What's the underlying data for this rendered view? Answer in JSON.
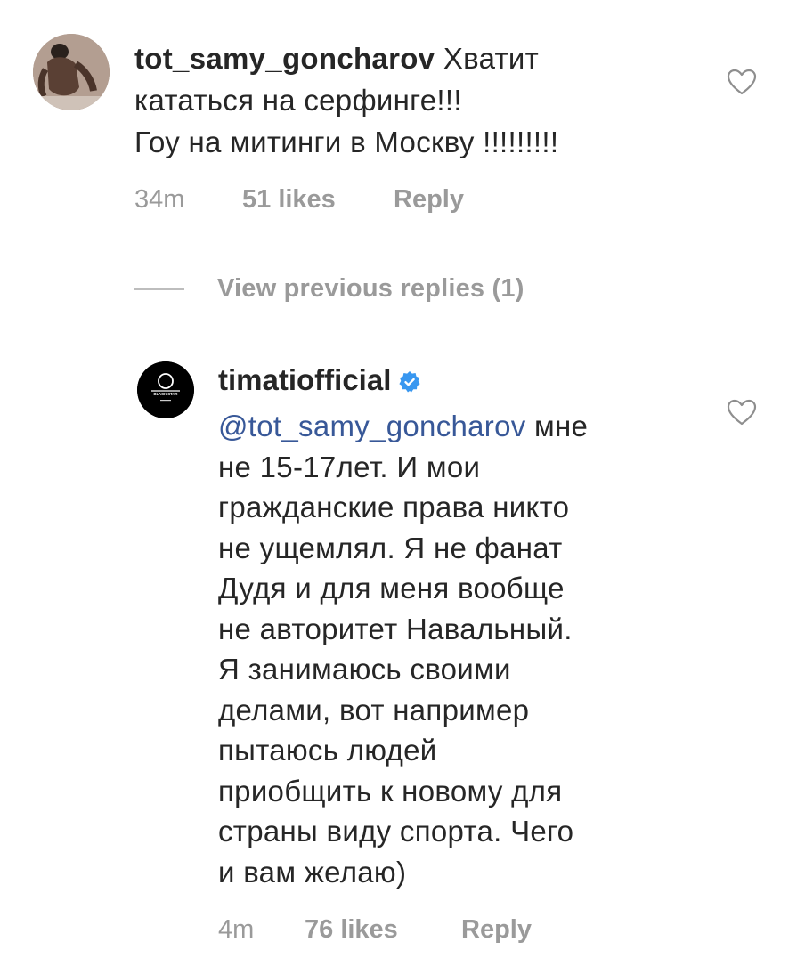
{
  "comment1": {
    "username": "tot_samy_goncharov",
    "text_line1": "Хватит",
    "text_line2": "кататься на серфинге!!!",
    "text_line3": "Гоу на митинги в Москву !!!!!!!!!",
    "time": "34m",
    "likes": "51 likes",
    "reply_label": "Reply",
    "like_icon": "heart-outline-icon"
  },
  "view_previous_replies": "View previous replies (1)",
  "comment2": {
    "username": "timatiofficial",
    "verified_icon": "verified-badge-icon",
    "mention": "@tot_samy_goncharov",
    "lines": [
      "мне",
      "не 15-17лет. И мои",
      "гражданские права никто",
      "не ущемлял. Я не фанат",
      "Дудя и для меня вообще",
      "не авторитет Навальный.",
      "Я занимаюсь своими",
      "делами, вот например",
      "пытаюсь людей",
      "приобщить к новому для",
      "страны виду спорта. Чего",
      "и вам желаю)"
    ],
    "avatar_text": "BLACK STAR",
    "time": "4m",
    "likes": "76 likes",
    "reply_label": "Reply",
    "like_icon": "heart-outline-icon"
  },
  "colors": {
    "text": "#262626",
    "secondary": "#9a9a9a",
    "mention": "#385898",
    "verified": "#3897f0"
  }
}
